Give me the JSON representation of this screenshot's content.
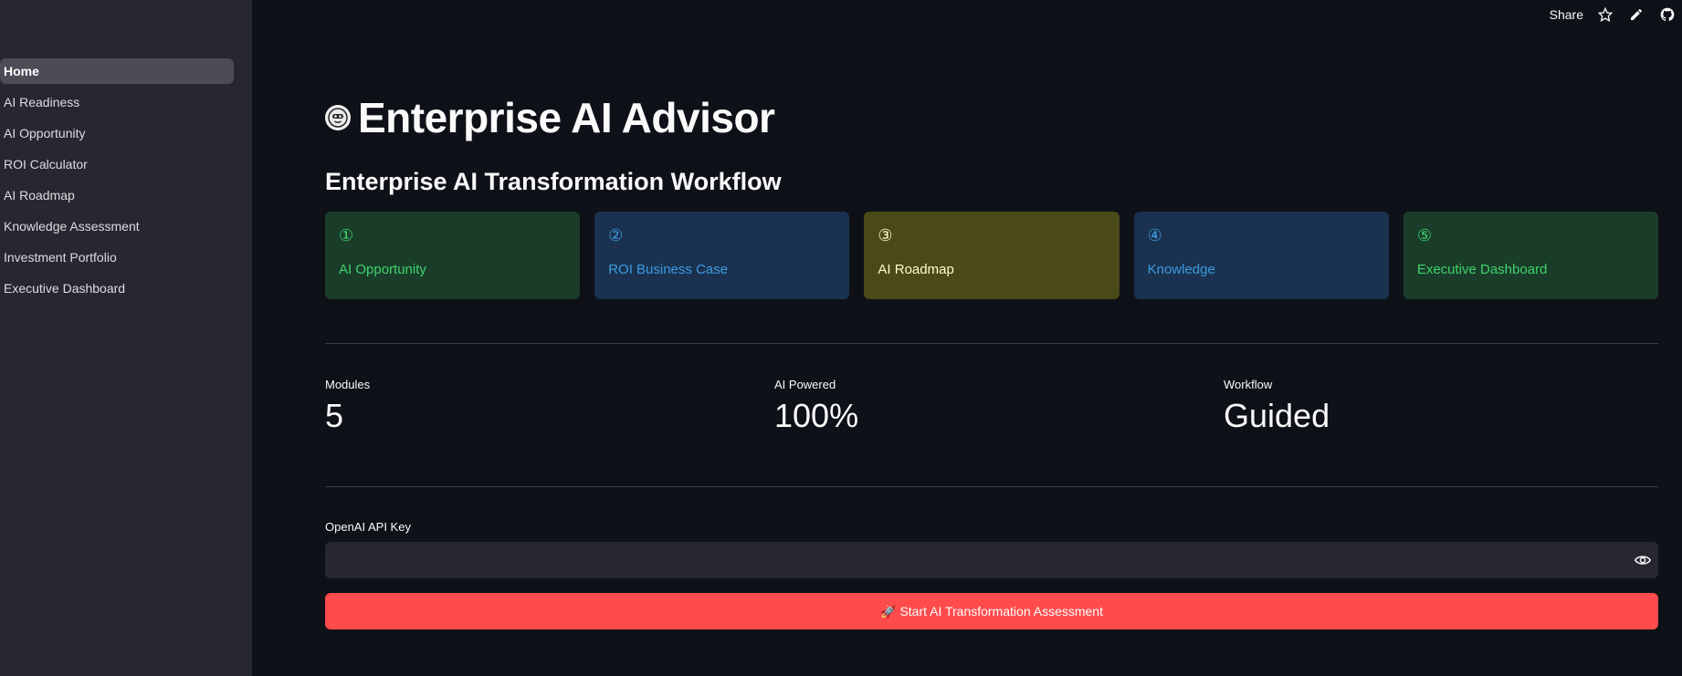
{
  "header": {
    "share_label": "Share",
    "icons": [
      "star-icon",
      "edit-pencil-icon",
      "github-icon"
    ]
  },
  "sidebar": {
    "items": [
      {
        "label": "Home",
        "active": true
      },
      {
        "label": "AI Readiness"
      },
      {
        "label": "AI Opportunity"
      },
      {
        "label": "ROI Calculator"
      },
      {
        "label": "AI Roadmap"
      },
      {
        "label": "Knowledge Assessment"
      },
      {
        "label": "Investment Portfolio"
      },
      {
        "label": "Executive Dashboard"
      }
    ]
  },
  "main": {
    "title_icon": "robot-face-icon",
    "title": "Enterprise AI Advisor",
    "workflow_title": "Enterprise AI Transformation Workflow",
    "steps": [
      {
        "num": "①",
        "label": "AI Opportunity",
        "color": "#3fd36b"
      },
      {
        "num": "②",
        "label": "ROI Business Case",
        "color": "#3d9ae0"
      },
      {
        "num": "③",
        "label": "AI Roadmap",
        "color": "#fffcd0"
      },
      {
        "num": "④",
        "label": "Knowledge",
        "color": "#3d9ae0"
      },
      {
        "num": "⑤",
        "label": "Executive Dashboard",
        "color": "#3fd36b"
      }
    ],
    "metrics": [
      {
        "label": "Modules",
        "value": "5"
      },
      {
        "label": "AI Powered",
        "value": "100%"
      },
      {
        "label": "Workflow",
        "value": "Guided"
      }
    ],
    "api_key": {
      "label": "OpenAI API Key",
      "value": "",
      "placeholder": ""
    },
    "start_button": {
      "icon": "rocket-icon",
      "label": "Start AI Transformation Assessment",
      "color": "#ff4b4b"
    }
  }
}
